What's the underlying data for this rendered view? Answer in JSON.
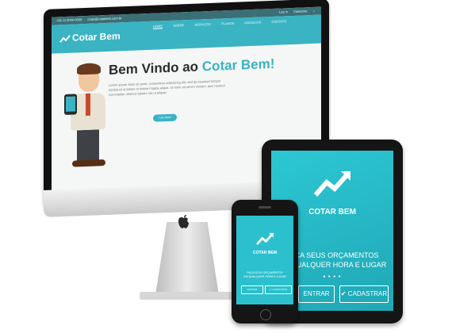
{
  "imac": {
    "topbar": {
      "phone": "+55 11 0000-0000",
      "email": "cotar@cotarbem.com.br",
      "login": "Log in",
      "signup": "Cadastrar"
    },
    "nav": {
      "brand": "Cotar Bem",
      "links": [
        "HOME",
        "SOBRE",
        "SERVIÇOS",
        "PLANOS",
        "ANÚNCIOS",
        "CONTATO"
      ]
    },
    "hero": {
      "title_prefix": "Bem Vindo ao",
      "title_accent": "Cotar Bem!",
      "text": "Lorem ipsum dolor sit amet, consectetur adipisicing elit, sed do eiusmod tempor incididunt ut labore et dolore magna aliqua. Ut enim ad minim veniam, quis nostrud exercitation ullamco laboris nisi ut aliquip.",
      "button": "Leia Mais"
    },
    "apple_logo": ""
  },
  "ipad": {
    "brand": "COTAR BEM",
    "tagline_line1": "FAÇA SEUS ORÇAMENTOS",
    "tagline_line2": "EM QUALQUER HORA E LUGAR",
    "dots": "● ● ● ●",
    "enter_button": "ENTRAR",
    "signup_button": "✔ CADASTRAR"
  },
  "iphone": {
    "brand": "COTAR BEM",
    "tagline_line1": "FAÇA SEUS ORÇAMENTOS",
    "tagline_line2": "EM QUALQUER HORA E LUGAR",
    "enter_button": "ENTRAR",
    "signup_button": "✔ CADASTRAR"
  },
  "colors": {
    "accent": "#3ab3c3",
    "topbar": "#3a6f75",
    "device_frame": "#151515"
  }
}
